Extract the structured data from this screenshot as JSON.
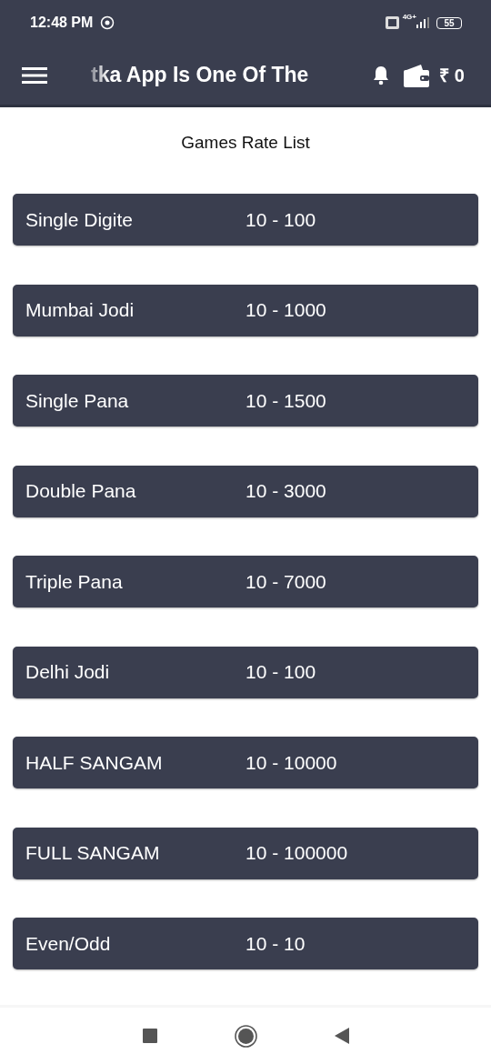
{
  "status_bar": {
    "time": "12:48 PM",
    "network": "4G+",
    "battery": "55"
  },
  "app_bar": {
    "title": "tka App Is One Of The",
    "balance": "₹ 0"
  },
  "page_title": "Games Rate List",
  "rates": [
    {
      "game": "Single Digite",
      "rate": "10 - 100"
    },
    {
      "game": "Mumbai Jodi",
      "rate": "10 - 1000"
    },
    {
      "game": "Single Pana",
      "rate": "10 - 1500"
    },
    {
      "game": "Double Pana",
      "rate": "10 - 3000"
    },
    {
      "game": "Triple Pana",
      "rate": "10 - 7000"
    },
    {
      "game": "Delhi Jodi",
      "rate": "10 - 100"
    },
    {
      "game": "HALF SANGAM",
      "rate": "10 - 10000"
    },
    {
      "game": "FULL SANGAM",
      "rate": "10 - 100000"
    },
    {
      "game": "Even/Odd",
      "rate": "10 - 10"
    }
  ]
}
